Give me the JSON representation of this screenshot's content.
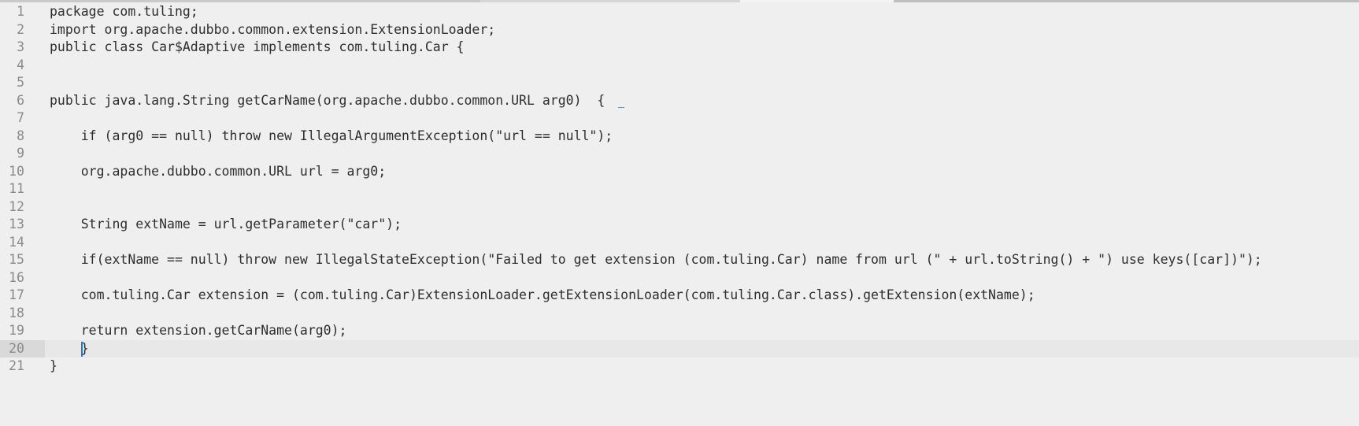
{
  "editor": {
    "current_line": 20,
    "lines": [
      {
        "num": "1",
        "code": "package com.tuling;"
      },
      {
        "num": "2",
        "code": "import org.apache.dubbo.common.extension.ExtensionLoader;"
      },
      {
        "num": "3",
        "code": "public class Car$Adaptive implements com.tuling.Car {"
      },
      {
        "num": "4",
        "code": ""
      },
      {
        "num": "5",
        "code": ""
      },
      {
        "num": "6",
        "code": "public java.lang.String getCarName(org.apache.dubbo.common.URL arg0)  {"
      },
      {
        "num": "7",
        "code": ""
      },
      {
        "num": "8",
        "code": "    if (arg0 == null) throw new IllegalArgumentException(\"url == null\");"
      },
      {
        "num": "9",
        "code": ""
      },
      {
        "num": "10",
        "code": "    org.apache.dubbo.common.URL url = arg0;"
      },
      {
        "num": "11",
        "code": ""
      },
      {
        "num": "12",
        "code": ""
      },
      {
        "num": "13",
        "code": "    String extName = url.getParameter(\"car\");"
      },
      {
        "num": "14",
        "code": ""
      },
      {
        "num": "15",
        "code": "    if(extName == null) throw new IllegalStateException(\"Failed to get extension (com.tuling.Car) name from url (\" + url.toString() + \") use keys([car])\");"
      },
      {
        "num": "16",
        "code": ""
      },
      {
        "num": "17",
        "code": "    com.tuling.Car extension = (com.tuling.Car)ExtensionLoader.getExtensionLoader(com.tuling.Car.class).getExtension(extName);"
      },
      {
        "num": "18",
        "code": ""
      },
      {
        "num": "19",
        "code": "    return extension.getCarName(arg0);"
      },
      {
        "num": "20",
        "code": "    }"
      },
      {
        "num": "21",
        "code": "}"
      }
    ]
  },
  "colors": {
    "background": "#efefef",
    "line_number": "#8a8a8a",
    "text": "#2e2e2e",
    "caret": "#1e78d6"
  }
}
